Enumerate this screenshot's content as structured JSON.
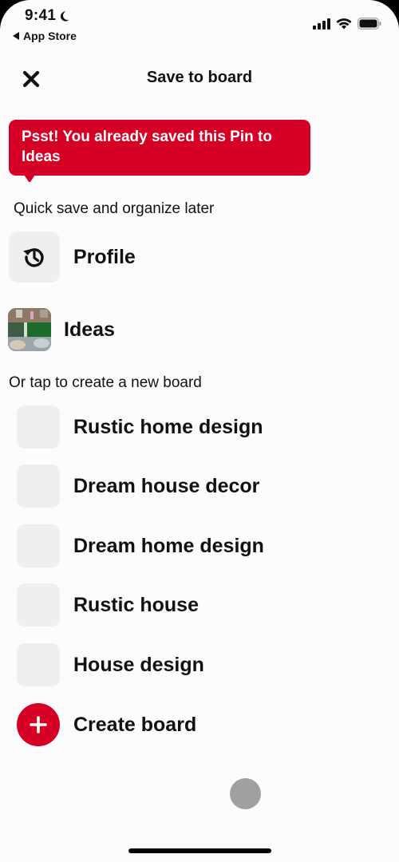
{
  "status_bar": {
    "time": "9:41",
    "back_app": "App Store",
    "icons": [
      "moon-icon",
      "cellular-signal-icon",
      "wifi-icon",
      "battery-icon"
    ]
  },
  "header": {
    "title": "Save to board",
    "close_icon": "close-icon"
  },
  "tooltip": {
    "text": "Psst! You already saved this Pin to Ideas",
    "color": "#d60027"
  },
  "quick_save": {
    "label": "Quick save and organize later",
    "items": [
      {
        "label": "Profile",
        "icon": "history-icon"
      },
      {
        "label": "Ideas",
        "icon": "board-thumbnail"
      }
    ]
  },
  "create_section": {
    "label": "Or tap to create a new board",
    "suggestions": [
      {
        "label": "Rustic home design"
      },
      {
        "label": "Dream house decor"
      },
      {
        "label": "Dream home design"
      },
      {
        "label": "Rustic house"
      },
      {
        "label": "House design"
      }
    ],
    "create_button": {
      "label": "Create board",
      "icon": "plus-icon",
      "color": "#d60027"
    }
  }
}
